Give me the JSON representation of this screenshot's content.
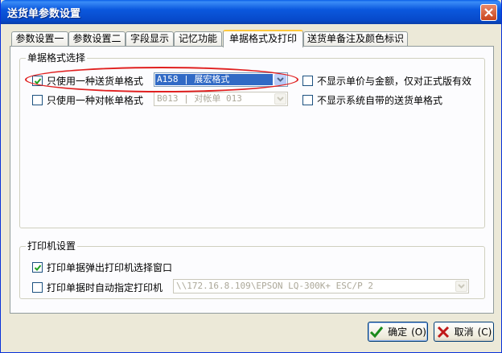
{
  "window": {
    "title": "送货单参数设置"
  },
  "tabs": [
    {
      "label": "参数设置一",
      "active": false
    },
    {
      "label": "参数设置二",
      "active": false
    },
    {
      "label": "字段显示",
      "active": false
    },
    {
      "label": "记忆功能",
      "active": false
    },
    {
      "label": "单据格式及打印",
      "active": true
    },
    {
      "label": "送货单备注及颜色标识",
      "active": false
    }
  ],
  "format_group": {
    "legend": "单据格式选择",
    "delivery_format": {
      "label": "只使用一种送货单格式",
      "checked": true,
      "value": "A158 | 展宏格式"
    },
    "statement_format": {
      "label": "只使用一种对帐单格式",
      "checked": false,
      "value": "B013 | 对帐单 013"
    },
    "hide_price_amount": {
      "label": "不显示单价与金额，仅对正式版有效",
      "checked": false
    },
    "hide_builtin_formats": {
      "label": "不显示系统自带的送货单格式",
      "checked": false
    }
  },
  "printer_group": {
    "legend": "打印机设置",
    "popup_printer_dialog": {
      "label": "打印单据弹出打印机选择窗口",
      "checked": true
    },
    "auto_assign_printer": {
      "label": "打印单据时自动指定打印机",
      "checked": false,
      "value": "\\\\172.16.8.109\\EPSON LQ-300K+ ESC/P 2"
    }
  },
  "buttons": {
    "ok": "确定",
    "ok_hotkey": "(O)",
    "cancel": "取消",
    "cancel_hotkey": "(C)"
  },
  "colors": {
    "title_bar": "#0b58de",
    "dialog_bg": "#ece9d8",
    "highlight_ring": "#e02020",
    "selection": "#316ac5"
  }
}
